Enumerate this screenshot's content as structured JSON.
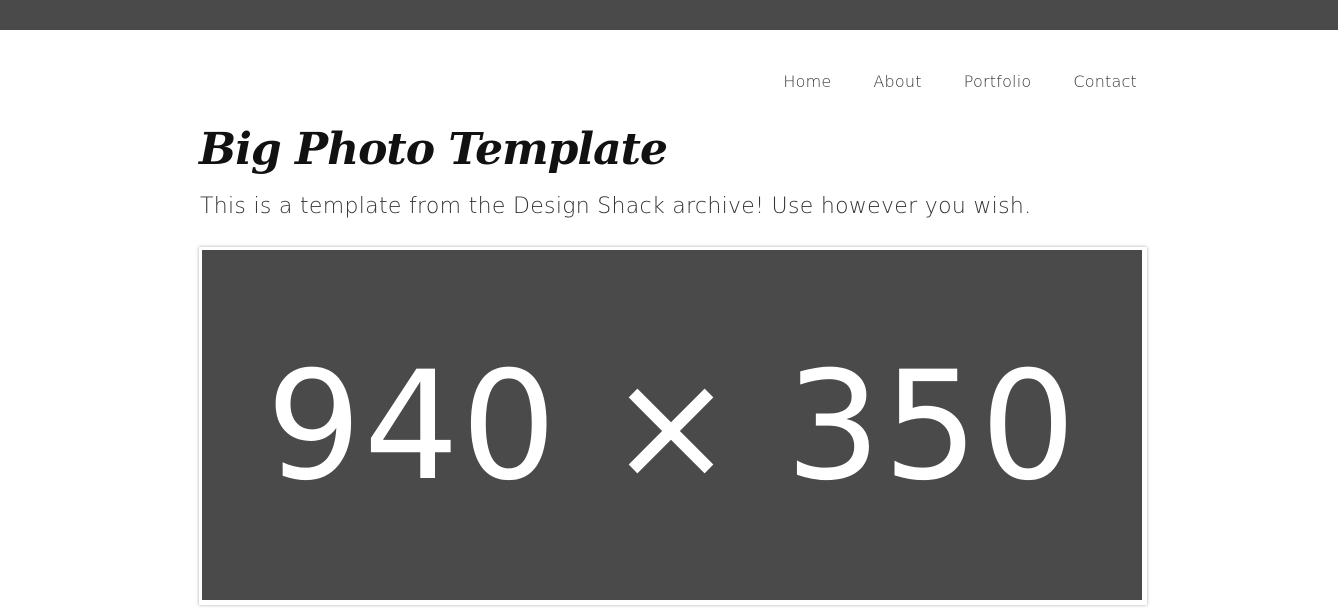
{
  "nav": {
    "items": [
      "Home",
      "About",
      "Portfolio",
      "Contact"
    ]
  },
  "header": {
    "title": "Big Photo Template",
    "subtitle": "This is a template from the Design Shack archive! Use however you wish."
  },
  "hero": {
    "placeholder_text": "940 × 350"
  },
  "colors": {
    "topbar": "#4a4a4a",
    "placeholder_bg": "#4a4a4a",
    "placeholder_text": "#ffffff"
  }
}
